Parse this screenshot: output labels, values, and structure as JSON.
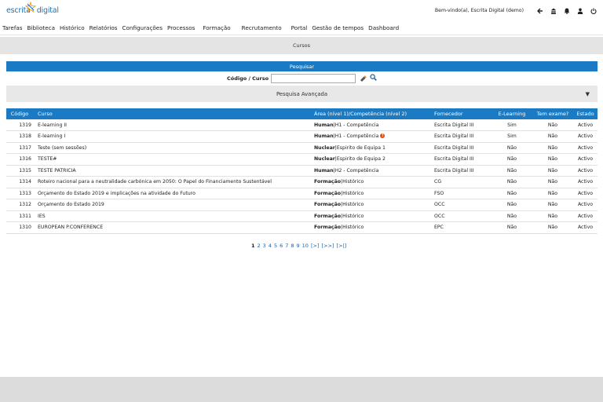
{
  "brand": {
    "part1": "escrita",
    "part2": "digital",
    "accent": "#1a7bc4"
  },
  "header": {
    "welcome": "Bem-vindo(a), Escrita Digital (demo)",
    "icons": [
      "back-arrow-icon",
      "building-icon",
      "bell-icon",
      "user-icon",
      "power-icon"
    ]
  },
  "menu": [
    "Tarefas",
    "Biblioteca",
    "Histórico",
    "Relatórios",
    "Configurações",
    "Processos",
    "Formação",
    "Recrutamento",
    "Portal",
    "Gestão de tempos",
    "Dashboard"
  ],
  "page": {
    "title": "Cursos"
  },
  "search": {
    "header": "Pesquisar",
    "label": "Código / Curso",
    "value": "",
    "advanced": "Pesquisa Avançada"
  },
  "table": {
    "headers": {
      "code": "Código",
      "course": "Curso",
      "area": "Área (nível 1)/Competência (nível 2)",
      "supplier": "Fornecedor",
      "elearning": "E-Learning",
      "exam": "Tem exame?",
      "status": "Estado"
    },
    "rows": [
      {
        "code": "1319",
        "course": "E-learning II",
        "area1": "Human",
        "area2": "|H1 - Competência",
        "supplier": "Escrita Digital III",
        "elearning": "Sim",
        "exam": "Não",
        "status": "Activo"
      },
      {
        "code": "1318",
        "course": "E-learning I",
        "area1": "Human",
        "area2": "|H1 - Competência",
        "supplier": "Escrita Digital III",
        "elearning": "Sim",
        "exam": "Não",
        "status": "Activo"
      },
      {
        "code": "1317",
        "course": "Teste (sem sessões)",
        "area1": "Nuclear",
        "area2": "|Espirito de Equipa 1",
        "supplier": "Escrita Digital III",
        "elearning": "Não",
        "exam": "Não",
        "status": "Activo"
      },
      {
        "code": "1316",
        "course": "TESTE#",
        "area1": "Nuclear",
        "area2": "|Espirito de Equipa 2",
        "supplier": "Escrita Digital III",
        "elearning": "Não",
        "exam": "Não",
        "status": "Activo"
      },
      {
        "code": "1315",
        "course": "TESTE PATRICIA",
        "area1": "Human",
        "area2": "|H2 - Competência",
        "supplier": "Escrita Digital III",
        "elearning": "Não",
        "exam": "Não",
        "status": "Activo"
      },
      {
        "code": "1314",
        "course": "Roteiro nacional para a neutralidade carbónica em 2050: O Papel do Financiamento Sustentável",
        "area1": "Formação",
        "area2": "|Histórico",
        "supplier": "CG",
        "elearning": "Não",
        "exam": "Não",
        "status": "Activo"
      },
      {
        "code": "1313",
        "course": "Orçamento do Estado 2019 e implicações na atividade do Futuro",
        "area1": "Formação",
        "area2": "|Histórico",
        "supplier": "FSO",
        "elearning": "Não",
        "exam": "Não",
        "status": "Activo"
      },
      {
        "code": "1312",
        "course": "Orçamento do Estado 2019",
        "area1": "Formação",
        "area2": "|Histórico",
        "supplier": "OCC",
        "elearning": "Não",
        "exam": "Não",
        "status": "Activo"
      },
      {
        "code": "1311",
        "course": "IES",
        "area1": "Formação",
        "area2": "|Histórico",
        "supplier": "OCC",
        "elearning": "Não",
        "exam": "Não",
        "status": "Activo"
      },
      {
        "code": "1310",
        "course": "EUROPEAN P.CONFERENCE",
        "area1": "Formação",
        "area2": "|Histórico",
        "supplier": "EPC",
        "elearning": "Não",
        "exam": "Não",
        "status": "Activo"
      }
    ]
  },
  "pagination": [
    "1",
    "2",
    "3",
    "4",
    "5",
    "6",
    "7",
    "8",
    "9",
    "10",
    "[>]",
    "[>>]",
    "[>|]"
  ],
  "pagination_current": "1"
}
